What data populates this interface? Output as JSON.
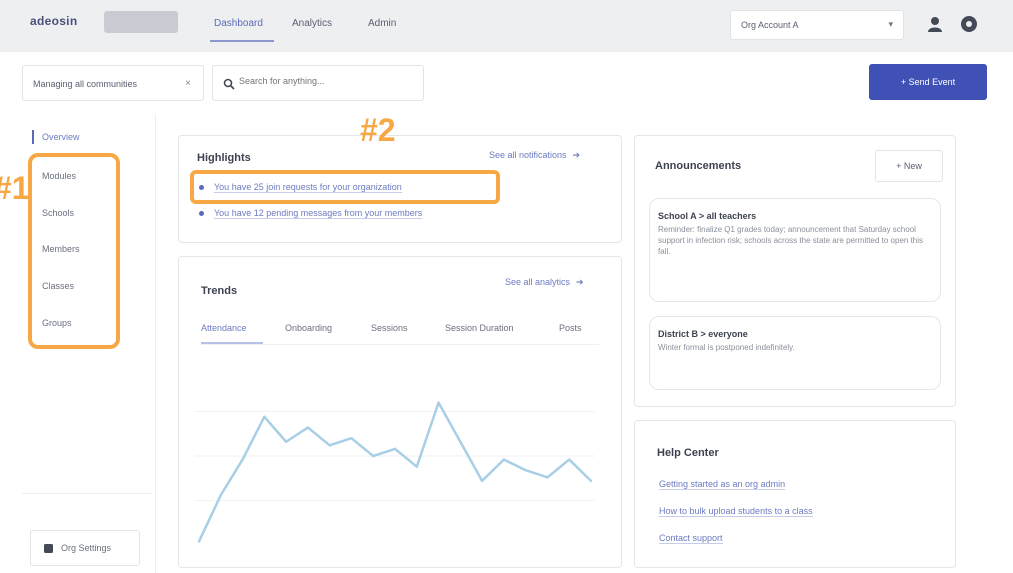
{
  "header": {
    "logo": "adeosin",
    "badge": "",
    "nav": [
      "Dashboard",
      "Analytics",
      "Admin"
    ],
    "org_select": "Org Account A"
  },
  "toolbar": {
    "org_filter": "Managing all communities",
    "search_placeholder": "Search for anything...",
    "create_button": "+ Send Event"
  },
  "sidebar": {
    "items": [
      "Overview",
      "Modules",
      "Schools",
      "Members",
      "Classes",
      "Groups"
    ],
    "settings": "Org Settings"
  },
  "highlights": {
    "title": "Highlights",
    "see_all": "See all notifications",
    "items": [
      "You have 25 join requests for your organization",
      "You have 12 pending messages from your members"
    ]
  },
  "trends": {
    "title": "Trends",
    "see_all": "See all analytics",
    "tabs": [
      "Attendance",
      "Onboarding",
      "Sessions",
      "Session Duration",
      "Posts"
    ]
  },
  "announcements": {
    "title": "Announcements",
    "new_button": "+ New",
    "cards": [
      {
        "head": "School A > all teachers",
        "body": "Reminder: finalize Q1 grades today; announcement that Saturday school support in infection risk; schools across the state are permitted to open this fall."
      },
      {
        "head": "District B > everyone",
        "body": "Winter formal is postponed indefinitely."
      }
    ]
  },
  "help_center": {
    "title": "Help Center",
    "links": [
      "Getting started as an org admin",
      "How to bulk upload students to a class",
      "Contact support"
    ]
  },
  "annotations": {
    "label1": "#1",
    "label2": "#2"
  },
  "chart_data": {
    "type": "line",
    "series": [
      {
        "values": [
          2,
          28,
          48,
          72,
          58,
          66,
          56,
          60,
          50,
          54,
          44,
          80,
          58,
          36,
          48,
          42,
          38,
          48,
          36
        ]
      }
    ],
    "ylim": [
      0,
      100
    ],
    "grid": true,
    "color": "#a9cfe6"
  }
}
